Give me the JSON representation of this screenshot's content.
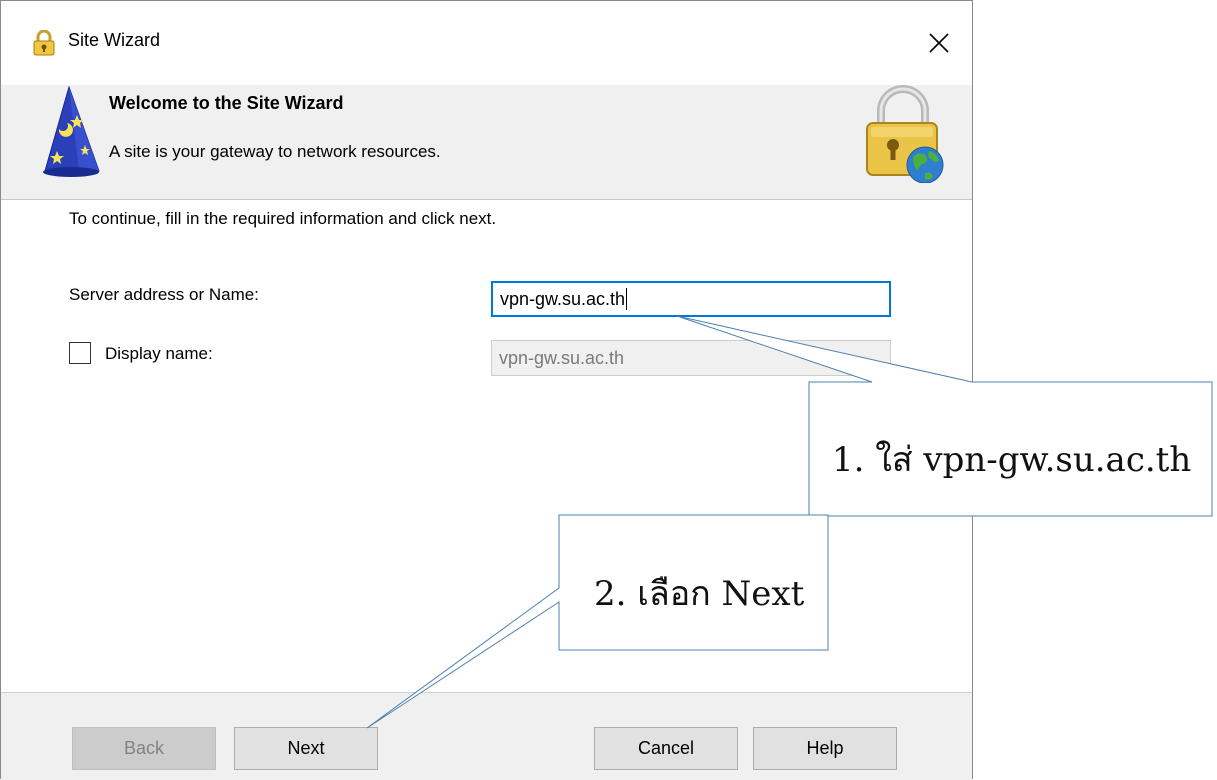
{
  "window": {
    "title": "Site Wizard"
  },
  "header": {
    "title": "Welcome to the Site Wizard",
    "subtitle": "A site is your gateway to network resources."
  },
  "body": {
    "instruction": "To continue, fill in the required information and click next.",
    "server": {
      "label": "Server address or Name:",
      "value": "vpn-gw.su.ac.th"
    },
    "display_name": {
      "label": "Display name:",
      "value": "vpn-gw.su.ac.th",
      "checked": false
    }
  },
  "footer": {
    "back": "Back",
    "next": "Next",
    "cancel": "Cancel",
    "help": "Help"
  },
  "annotations": {
    "step1": "1. ใส่ vpn-gw.su.ac.th",
    "step2": "2. เลือก Next"
  },
  "colors": {
    "input_focus_border": "#0078d7",
    "callout_border": "#4a7fb0"
  },
  "icons": {
    "title": "lock-icon",
    "close": "close-icon",
    "header_left": "wizard-hat-icon",
    "header_right": "lock-globe-icon"
  }
}
